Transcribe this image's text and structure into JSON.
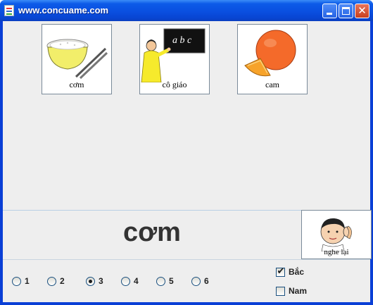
{
  "window": {
    "title": "www.concuame.com"
  },
  "cards": [
    {
      "label": "cơm",
      "icon": "rice-bowl-icon"
    },
    {
      "label": "cô giáo",
      "icon": "teacher-icon"
    },
    {
      "label": "cam",
      "icon": "orange-icon"
    }
  ],
  "word": {
    "text": "cơm"
  },
  "listen": {
    "label": "nghe lại",
    "icon": "boy-listening-icon"
  },
  "radios": [
    {
      "label": "1",
      "selected": false
    },
    {
      "label": "2",
      "selected": false
    },
    {
      "label": "3",
      "selected": true
    },
    {
      "label": "4",
      "selected": false
    },
    {
      "label": "5",
      "selected": false
    },
    {
      "label": "6",
      "selected": false
    }
  ],
  "checks": [
    {
      "label": "Bắc",
      "checked": true
    },
    {
      "label": "Nam",
      "checked": false
    }
  ],
  "colors": {
    "titlebar": "#0a4fe0",
    "client": "#eeeeee",
    "word": "#333333"
  }
}
